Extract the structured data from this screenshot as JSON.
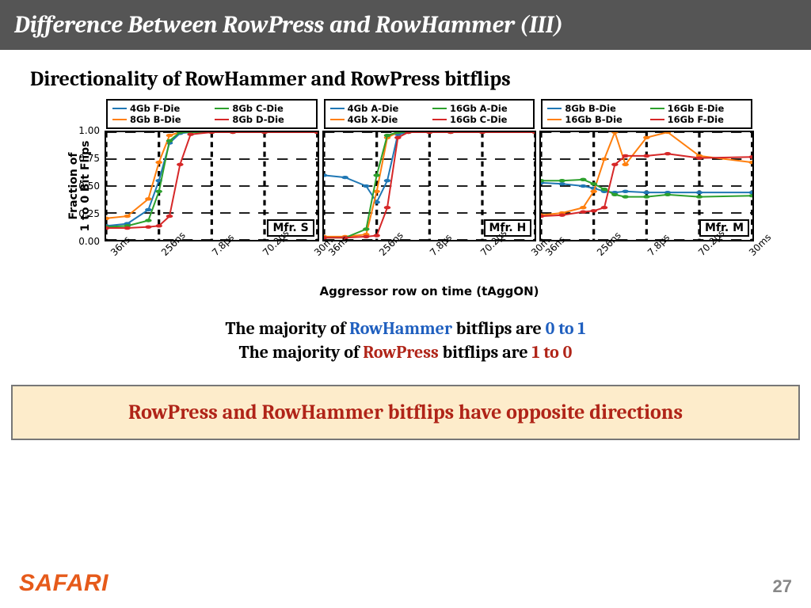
{
  "title": "Difference Between RowPress and RowHammer (III)",
  "subtitle": "Directionality of RowHammer and RowPress bitflips",
  "ylabel": "Fraction of\n1 to 0 Bit Flips",
  "xlabel": "Aggressor row on time (tAggON)",
  "xticks": [
    "36ns",
    "256ns",
    "7.8µs",
    "70.2µs",
    "30ms"
  ],
  "yticks": [
    "0.00",
    "0.25",
    "0.50",
    "0.75",
    "1.00"
  ],
  "panels": [
    {
      "mfr": "Mfr. S",
      "legend": [
        {
          "name": "4Gb F-Die",
          "color": "#1f77b4"
        },
        {
          "name": "8Gb C-Die",
          "color": "#2ca02c"
        },
        {
          "name": "8Gb B-Die",
          "color": "#ff7f0e"
        },
        {
          "name": "8Gb D-Die",
          "color": "#d62728"
        }
      ]
    },
    {
      "mfr": "Mfr. H",
      "legend": [
        {
          "name": "4Gb A-Die",
          "color": "#1f77b4"
        },
        {
          "name": "16Gb A-Die",
          "color": "#2ca02c"
        },
        {
          "name": "4Gb X-Die",
          "color": "#ff7f0e"
        },
        {
          "name": "16Gb C-Die",
          "color": "#d62728"
        }
      ]
    },
    {
      "mfr": "Mfr. M",
      "legend": [
        {
          "name": "8Gb B-Die",
          "color": "#1f77b4"
        },
        {
          "name": "16Gb E-Die",
          "color": "#2ca02c"
        },
        {
          "name": "16Gb B-Die",
          "color": "#ff7f0e"
        },
        {
          "name": "16Gb F-Die",
          "color": "#d62728"
        }
      ]
    }
  ],
  "chart_data": [
    {
      "type": "line",
      "title": "Mfr. S",
      "xlabel": "Aggressor row on time (tAggON)",
      "ylabel": "Fraction of 1 to 0 Bit Flips",
      "ylim": [
        0,
        1
      ],
      "x": [
        0,
        0.1,
        0.2,
        0.25,
        0.3,
        0.35,
        0.4,
        0.5,
        0.6,
        0.75,
        1.0
      ],
      "series": [
        {
          "name": "4Gb F-Die",
          "color": "#1f77b4",
          "values": [
            0.13,
            0.15,
            0.28,
            0.55,
            0.9,
            0.99,
            1.0,
            1.0,
            1.0,
            1.0,
            1.0
          ]
        },
        {
          "name": "8Gb B-Die",
          "color": "#ff7f0e",
          "values": [
            0.2,
            0.22,
            0.38,
            0.72,
            0.97,
            1.0,
            1.0,
            1.0,
            1.0,
            1.0,
            1.0
          ]
        },
        {
          "name": "8Gb C-Die",
          "color": "#2ca02c",
          "values": [
            0.12,
            0.13,
            0.18,
            0.45,
            0.92,
            1.0,
            1.0,
            1.0,
            1.0,
            1.0,
            1.0
          ]
        },
        {
          "name": "8Gb D-Die",
          "color": "#d62728",
          "values": [
            0.11,
            0.11,
            0.12,
            0.13,
            0.22,
            0.7,
            0.98,
            1.0,
            1.0,
            1.0,
            1.0
          ]
        }
      ]
    },
    {
      "type": "line",
      "title": "Mfr. H",
      "xlabel": "Aggressor row on time (tAggON)",
      "ylabel": "Fraction of 1 to 0 Bit Flips",
      "ylim": [
        0,
        1
      ],
      "x": [
        0,
        0.1,
        0.2,
        0.25,
        0.3,
        0.35,
        0.4,
        0.5,
        0.6,
        0.75,
        1.0
      ],
      "series": [
        {
          "name": "4Gb A-Die",
          "color": "#1f77b4",
          "values": [
            0.6,
            0.58,
            0.5,
            0.35,
            0.55,
            0.98,
            1.0,
            1.0,
            1.0,
            1.0,
            1.0
          ]
        },
        {
          "name": "4Gb X-Die",
          "color": "#ff7f0e",
          "values": [
            0.03,
            0.03,
            0.05,
            0.45,
            0.95,
            1.0,
            1.0,
            1.0,
            1.0,
            1.0,
            1.0
          ]
        },
        {
          "name": "16Gb A-Die",
          "color": "#2ca02c",
          "values": [
            0.02,
            0.02,
            0.1,
            0.6,
            0.97,
            1.0,
            1.0,
            1.0,
            1.0,
            1.0,
            1.0
          ]
        },
        {
          "name": "16Gb C-Die",
          "color": "#d62728",
          "values": [
            0.02,
            0.02,
            0.03,
            0.04,
            0.3,
            0.95,
            1.0,
            1.0,
            1.0,
            1.0,
            1.0
          ]
        }
      ]
    },
    {
      "type": "line",
      "title": "Mfr. M",
      "xlabel": "Aggressor row on time (tAggON)",
      "ylabel": "Fraction of 1 to 0 Bit Flips",
      "ylim": [
        0,
        1
      ],
      "x": [
        0,
        0.1,
        0.2,
        0.25,
        0.3,
        0.35,
        0.4,
        0.5,
        0.6,
        0.75,
        1.0
      ],
      "series": [
        {
          "name": "8Gb B-Die",
          "color": "#1f77b4",
          "values": [
            0.53,
            0.52,
            0.5,
            0.48,
            0.45,
            0.44,
            0.45,
            0.44,
            0.44,
            0.44,
            0.44
          ]
        },
        {
          "name": "16Gb B-Die",
          "color": "#ff7f0e",
          "values": [
            0.23,
            0.25,
            0.3,
            0.45,
            0.75,
            1.0,
            0.7,
            0.95,
            1.0,
            0.78,
            0.72
          ]
        },
        {
          "name": "16Gb E-Die",
          "color": "#2ca02c",
          "values": [
            0.55,
            0.55,
            0.56,
            0.52,
            0.47,
            0.42,
            0.4,
            0.4,
            0.42,
            0.4,
            0.41
          ]
        },
        {
          "name": "16Gb F-Die",
          "color": "#d62728",
          "values": [
            0.22,
            0.23,
            0.26,
            0.27,
            0.3,
            0.7,
            0.78,
            0.78,
            0.8,
            0.76,
            0.77
          ]
        }
      ]
    }
  ],
  "caption": {
    "l1a": "The majority of ",
    "l1b": "RowHammer",
    "l1c": " bitflips are ",
    "l1d": "0 to 1",
    "l2a": "The majority of ",
    "l2b": "RowPress",
    "l2c": " bitflips are ",
    "l2d": "1 to 0"
  },
  "highlight": "RowPress and RowHammer bitflips have opposite directions",
  "logo": "SAFARI",
  "page": "27"
}
